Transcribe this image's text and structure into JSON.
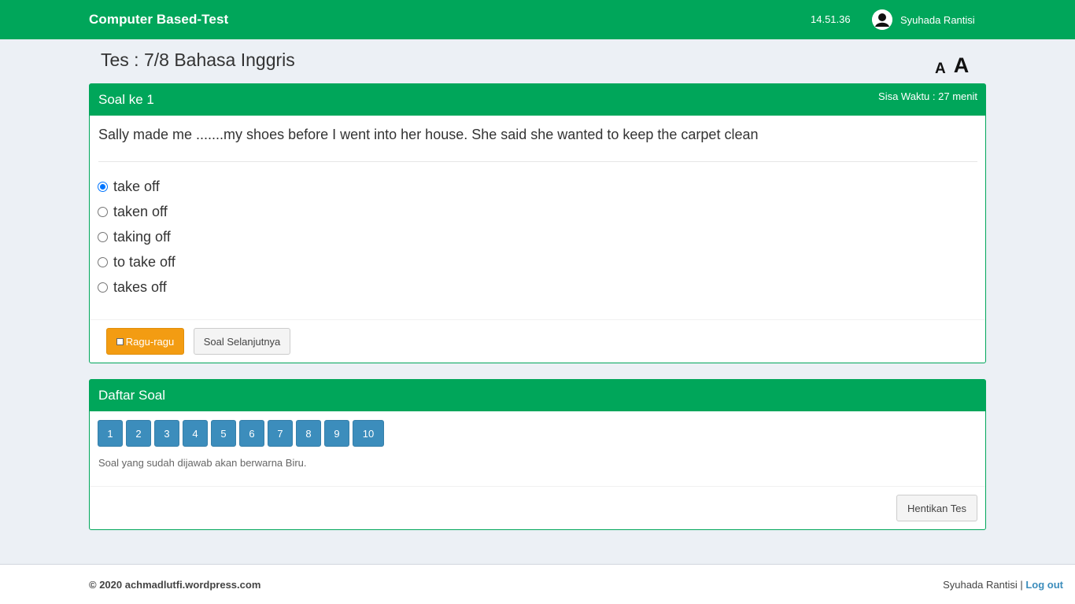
{
  "header": {
    "brand": "Computer Based-Test",
    "clock": "14.51.36",
    "user_name": "Syuhada Rantisi",
    "user_icon": "user-avatar-icon",
    "bg_color": "#00a65a"
  },
  "page": {
    "title": "Tes : 7/8 Bahasa Inggris",
    "font_small": "A",
    "font_large": "A"
  },
  "question": {
    "heading": "Soal ke 1",
    "timer": "Sisa Waktu : 27 menit",
    "text": "Sally made me .......my shoes before I went into her house. She said she wanted to keep the carpet clean",
    "options": [
      {
        "label": "take off",
        "checked": true
      },
      {
        "label": "taken off",
        "checked": false
      },
      {
        "label": "taking off",
        "checked": false
      },
      {
        "label": "to take off",
        "checked": false
      },
      {
        "label": "takes off",
        "checked": false
      }
    ],
    "doubt_label": "Ragu-ragu",
    "next_label": "Soal Selanjutnya"
  },
  "question_list": {
    "heading": "Daftar Soal",
    "numbers": [
      "1",
      "2",
      "3",
      "4",
      "5",
      "6",
      "7",
      "8",
      "9",
      "10"
    ],
    "hint": "Soal yang sudah dijawab akan berwarna Biru.",
    "stop_label": "Hentikan Tes",
    "answered_color": "#3c8dbc"
  },
  "footer": {
    "copyright": "© 2020 achmadlutfi.wordpress.com",
    "user_name": "Syuhada Rantisi",
    "separator": " | ",
    "logout": "Log out"
  }
}
